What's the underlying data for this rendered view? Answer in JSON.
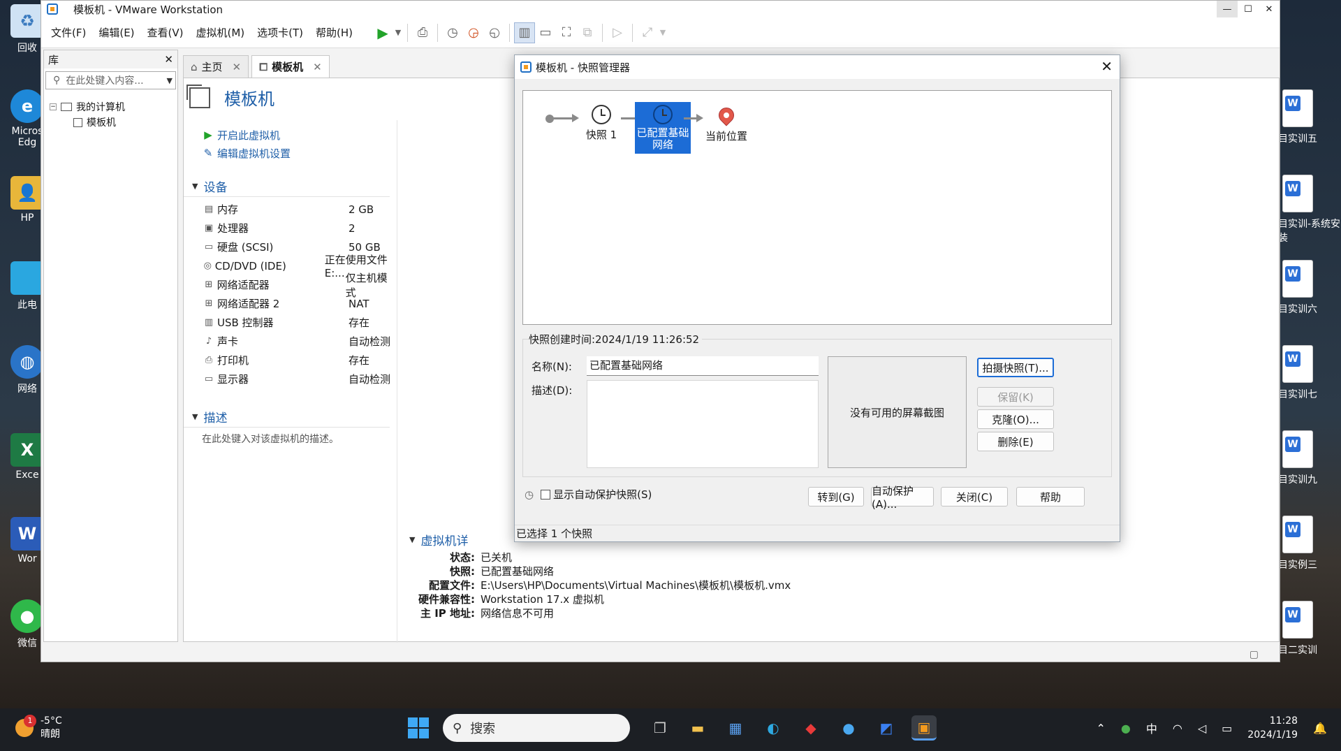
{
  "desktop": {
    "left_icons": [
      "回收",
      "Micros Edg",
      "HP",
      "此电",
      "网络",
      "Exce",
      "Wor",
      "微信"
    ],
    "right_files": [
      "目实训五",
      "目实训-系统安装",
      "目实训六",
      "目实训七",
      "目实训九",
      "目实例三",
      "目二实训"
    ]
  },
  "window": {
    "title": "模板机 - VMware Workstation",
    "controls": {
      "min": "—",
      "max": "☐",
      "close": "✕"
    }
  },
  "menu": [
    "文件(F)",
    "编辑(E)",
    "查看(V)",
    "虚拟机(M)",
    "选项卡(T)",
    "帮助(H)"
  ],
  "library": {
    "title": "库",
    "close": "✕",
    "search_placeholder": "在此处键入内容...",
    "tree": {
      "root": "我的计算机",
      "child": "模板机"
    }
  },
  "tabs": [
    {
      "label": "主页",
      "icon": "home-icon"
    },
    {
      "label": "模板机",
      "icon": "vm-icon"
    }
  ],
  "vm": {
    "name": "模板机",
    "actions": [
      "开启此虚拟机",
      "编辑虚拟机设置"
    ],
    "devices_title": "设备",
    "devices": [
      {
        "name": "内存",
        "value": "2 GB"
      },
      {
        "name": "处理器",
        "value": "2"
      },
      {
        "name": "硬盘 (SCSI)",
        "value": "50 GB"
      },
      {
        "name": "CD/DVD (IDE)",
        "value": "正在使用文件 E:..."
      },
      {
        "name": "网络适配器",
        "value": "仅主机模式"
      },
      {
        "name": "网络适配器 2",
        "value": "NAT"
      },
      {
        "name": "USB 控制器",
        "value": "存在"
      },
      {
        "name": "声卡",
        "value": "自动检测"
      },
      {
        "name": "打印机",
        "value": "存在"
      },
      {
        "name": "显示器",
        "value": "自动检测"
      }
    ],
    "desc_title": "描述",
    "desc_placeholder": "在此处键入对该虚拟机的描述。",
    "details_title": "虚拟机详",
    "details": [
      {
        "k": "状态:",
        "v": "已关机"
      },
      {
        "k": "快照:",
        "v": "已配置基础网络"
      },
      {
        "k": "配置文件:",
        "v": "E:\\Users\\HP\\Documents\\Virtual Machines\\模板机\\模板机.vmx"
      },
      {
        "k": "硬件兼容性:",
        "v": "Workstation 17.x 虚拟机"
      },
      {
        "k": "主 IP 地址:",
        "v": "网络信息不可用"
      }
    ]
  },
  "dialog": {
    "title": "模板机 - 快照管理器",
    "close": "✕",
    "nodes": {
      "snap1": "快照 1",
      "snap2": "已配置基础网络",
      "current": "当前位置"
    },
    "created": "快照创建时间:2024/1/19 11:26:52",
    "name_label": "名称(N):",
    "name_value": "已配置基础网络",
    "desc_label": "描述(D):",
    "no_screenshot": "没有可用的屏幕截图",
    "buttons": {
      "take": "拍摄快照(T)...",
      "keep": "保留(K)",
      "clone": "克隆(O)...",
      "delete": "删除(E)",
      "goto": "转到(G)",
      "autoprotect": "自动保护(A)...",
      "close": "关闭(C)",
      "help": "帮助"
    },
    "show_auto": "显示自动保护快照(S)",
    "status": "已选择 1 个快照"
  },
  "taskbar": {
    "temp": "-5°C",
    "weather": "晴朗",
    "badge": "1",
    "search": "搜索",
    "ime": "中",
    "time": "11:28",
    "date": "2024/1/19"
  }
}
